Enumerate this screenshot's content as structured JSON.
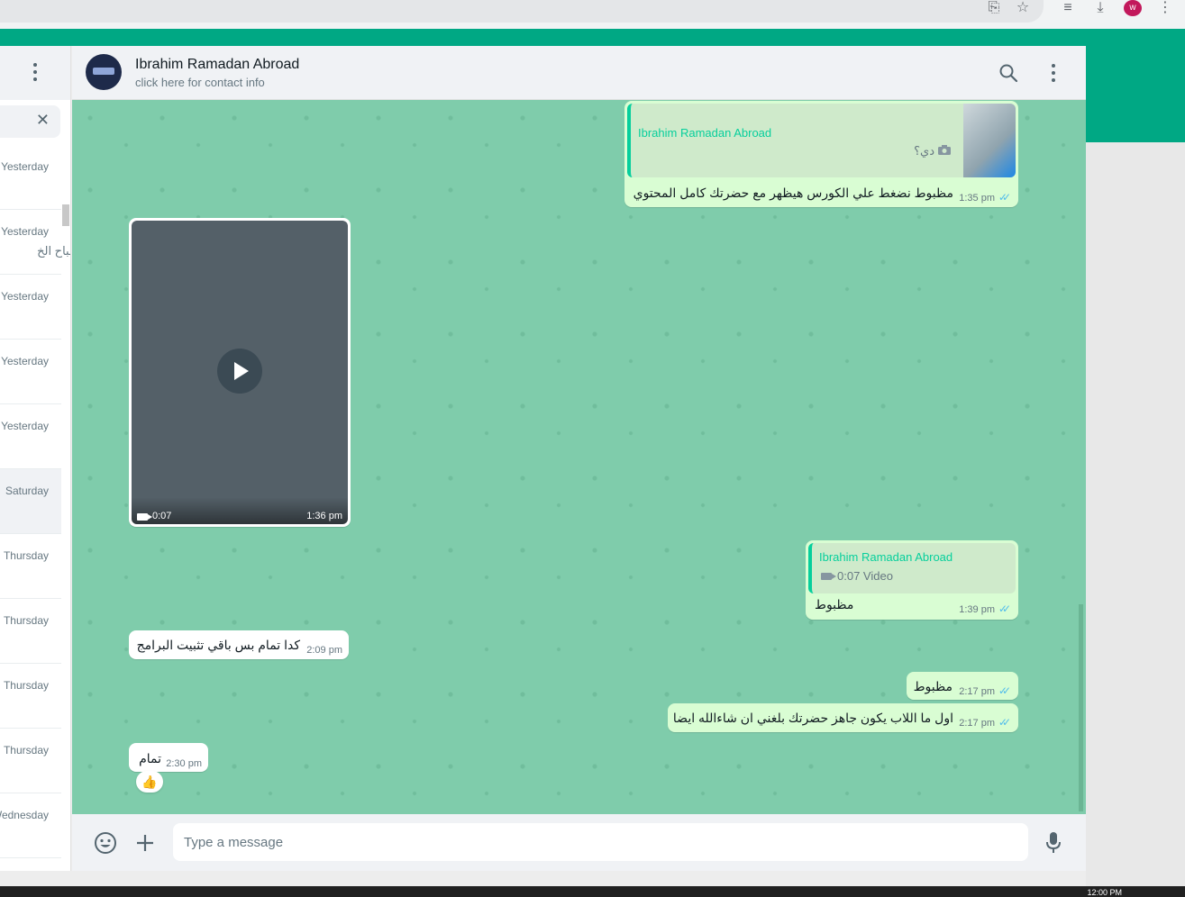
{
  "browser": {
    "profile_initial": "w"
  },
  "sidebar": {
    "chats": [
      {
        "time": "Yesterday",
        "preview": ""
      },
      {
        "time": "Yesterday",
        "preview": "صباح الخ"
      },
      {
        "time": "Yesterday",
        "preview": ""
      },
      {
        "time": "Yesterday",
        "preview": ""
      },
      {
        "time": "Yesterday",
        "preview": ""
      },
      {
        "time": "Saturday",
        "preview": "",
        "active": true
      },
      {
        "time": "Thursday",
        "preview": ""
      },
      {
        "time": "Thursday",
        "preview": ""
      },
      {
        "time": "Thursday",
        "preview": ""
      },
      {
        "time": "Thursday",
        "preview": ""
      },
      {
        "time": "Wednesday",
        "preview": ""
      }
    ]
  },
  "conversation": {
    "contact_name": "Ibrahim Ramadan Abroad",
    "contact_subtitle": "click here for contact info",
    "messages": [
      {
        "id": "m1",
        "direction": "out",
        "quote_author": "Ibrahim Ramadan Abroad",
        "quote_text": "دي؟",
        "text": "مظبوط نضغط علي الكورس هيظهر مع حضرتك كامل المحتوي",
        "time": "1:35 pm"
      },
      {
        "id": "m2",
        "direction": "in",
        "type": "video",
        "duration": "0:07",
        "time": "1:36 pm"
      },
      {
        "id": "m3",
        "direction": "out",
        "quote_author": "Ibrahim Ramadan Abroad",
        "quote_text": "0:07 Video",
        "text": "مظبوط",
        "time": "1:39 pm"
      },
      {
        "id": "m4",
        "direction": "in",
        "text": "كدا تمام بس باقي تثبيت البرامج",
        "time": "2:09 pm"
      },
      {
        "id": "m5",
        "direction": "out",
        "text": "مظبوط",
        "time": "2:17 pm"
      },
      {
        "id": "m6",
        "direction": "out",
        "text": "اول ما اللاب يكون جاهز حضرتك بلغني ان شاءالله ايضا",
        "time": "2:17 pm"
      },
      {
        "id": "m7",
        "direction": "in",
        "text": "تمام",
        "time": "2:30 pm",
        "reaction": "👍"
      }
    ]
  },
  "composer": {
    "placeholder": "Type a message"
  },
  "taskbar": {
    "clock": "12:00 PM"
  },
  "colors": {
    "accent": "#00a884",
    "outgoing_bubble": "#d9fdd3",
    "read_ticks": "#53bdeb",
    "chat_background": "#7fccab"
  }
}
